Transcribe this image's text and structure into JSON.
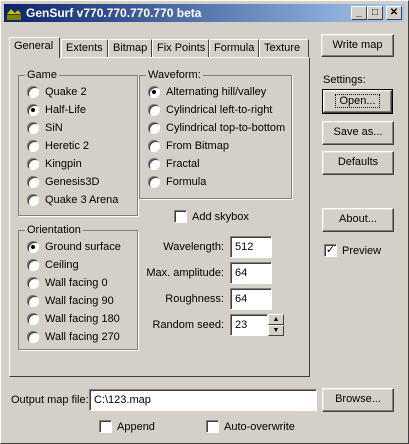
{
  "window": {
    "title": "GenSurf v770.770.770.770 beta"
  },
  "titlebar": {
    "min": "_",
    "max": "□",
    "close": "✕"
  },
  "tabs": [
    "General",
    "Extents",
    "Bitmap",
    "Fix Points",
    "Formula",
    "Texture"
  ],
  "game": {
    "label": "Game",
    "options": [
      "Quake 2",
      "Half-Life",
      "SiN",
      "Heretic 2",
      "Kingpin",
      "Genesis3D",
      "Quake 3 Arena"
    ],
    "selected": "Half-Life"
  },
  "waveform": {
    "label": "Waveform:",
    "options": [
      "Alternating hill/valley",
      "Cylindrical left-to-right",
      "Cylindrical top-to-bottom",
      "From Bitmap",
      "Fractal",
      "Formula"
    ],
    "selected": "Alternating hill/valley"
  },
  "skybox": {
    "label": "Add skybox",
    "checked": false
  },
  "orientation": {
    "label": "Orientation",
    "options": [
      "Ground surface",
      "Ceiling",
      "Wall facing 0",
      "Wall facing 90",
      "Wall facing 180",
      "Wall facing 270"
    ],
    "selected": "Ground surface"
  },
  "params": {
    "wavelength_label": "Wavelength:",
    "wavelength": "512",
    "amplitude_label": "Max. amplitude:",
    "amplitude": "64",
    "roughness_label": "Roughness:",
    "roughness": "64",
    "seed_label": "Random seed:",
    "seed": "23"
  },
  "right": {
    "write_map": "Write map",
    "settings_label": "Settings:",
    "open": "Open...",
    "save_as": "Save as...",
    "defaults": "Defaults",
    "about": "About...",
    "preview": "Preview",
    "preview_checked": true
  },
  "bottom": {
    "output_label": "Output map file:",
    "output_value": "C:\\123.map",
    "browse": "Browse...",
    "append": "Append",
    "append_checked": false,
    "auto_overwrite": "Auto-overwrite",
    "auto_overwrite_checked": false
  }
}
